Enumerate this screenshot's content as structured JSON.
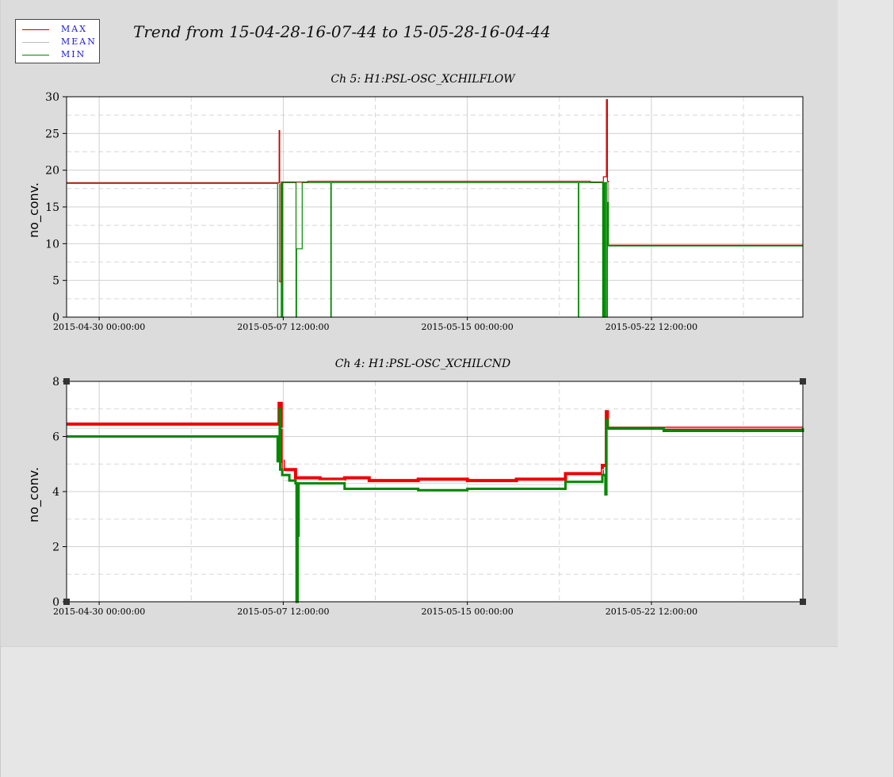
{
  "title": "Trend from 15-04-28-16-07-44 to 15-05-28-16-04-44",
  "legend": [
    {
      "label": "MAX",
      "color": "#cc0000"
    },
    {
      "label": "MEAN",
      "color": "#bbbbbb"
    },
    {
      "label": "MIN",
      "color": "#008800"
    }
  ],
  "chart_data": [
    {
      "type": "line",
      "title": "Ch 5: H1:PSL-OSC_XCHILFLOW",
      "ylabel": "no_conv.",
      "xlabel": "",
      "ylim": [
        0,
        30
      ],
      "xlim": [
        "2015-04-28 16:07:44",
        "2015-05-28 16:04:44"
      ],
      "yticks": [
        0,
        5,
        10,
        15,
        20,
        25,
        30
      ],
      "xticks": [
        "2015-04-30 00:00:00",
        "2015-05-07 12:00:00",
        "2015-05-15 00:00:00",
        "2015-05-22 12:00:00"
      ],
      "grid": true,
      "series": [
        {
          "name": "MAX",
          "color": "#cc0000",
          "x": [
            "2015-04-28 16:07:44",
            "2015-05-07 06:00:00",
            "2015-05-07 08:00:00",
            "2015-05-07 08:30:00",
            "2015-05-07 10:00:00",
            "2015-05-08 00:00:00",
            "2015-05-08 12:00:00",
            "2015-05-09 00:00:00",
            "2015-05-14 00:00:00",
            "2015-05-20 00:00:00",
            "2015-05-20 13:00:00",
            "2015-05-20 16:00:00",
            "2015-05-20 17:00:00",
            "2015-05-20 18:00:00",
            "2015-05-28 16:04:44"
          ],
          "y": [
            18.3,
            18.3,
            25.4,
            4.8,
            18.4,
            18.4,
            18.5,
            18.5,
            18.5,
            18.4,
            19.1,
            29.6,
            18.5,
            9.8,
            9.8
          ]
        },
        {
          "name": "MEAN",
          "color": "#bbbbbb",
          "x": [
            "2015-04-28 16:07:44",
            "2015-05-07 06:00:00",
            "2015-05-07 10:00:00",
            "2015-05-20 16:00:00",
            "2015-05-20 18:00:00",
            "2015-05-28 16:04:44"
          ],
          "y": [
            18.2,
            18.2,
            18.3,
            18.3,
            9.7,
            9.7
          ]
        },
        {
          "name": "MIN",
          "color": "#008800",
          "x": [
            "2015-04-28 16:07:44",
            "2015-05-07 06:00:00",
            "2015-05-07 06:30:00",
            "2015-05-07 07:00:00",
            "2015-05-07 09:00:00",
            "2015-05-07 09:30:00",
            "2015-05-07 10:00:00",
            "2015-05-07 10:30:00",
            "2015-05-07 11:00:00",
            "2015-05-07 11:30:00",
            "2015-05-07 12:00:00",
            "2015-05-08 00:00:00",
            "2015-05-08 00:30:00",
            "2015-05-08 01:00:00",
            "2015-05-08 06:00:00",
            "2015-05-08 06:30:00",
            "2015-05-08 08:00:00",
            "2015-05-08 08:30:00",
            "2015-05-08 09:00:00",
            "2015-05-09 10:00:00",
            "2015-05-09 10:30:00",
            "2015-05-09 11:00:00",
            "2015-05-19 12:00:00",
            "2015-05-19 12:30:00",
            "2015-05-19 13:00:00",
            "2015-05-20 12:00:00",
            "2015-05-20 12:20:00",
            "2015-05-20 12:40:00",
            "2015-05-20 13:00:00",
            "2015-05-20 13:20:00",
            "2015-05-20 13:40:00",
            "2015-05-20 14:00:00",
            "2015-05-20 15:00:00",
            "2015-05-20 15:20:00",
            "2015-05-20 16:00:00",
            "2015-05-20 16:30:00",
            "2015-05-20 17:00:00",
            "2015-05-20 18:00:00",
            "2015-05-28 16:04:44"
          ],
          "y": [
            18.2,
            18.2,
            0,
            0,
            0,
            0,
            18.2,
            18.3,
            0,
            18.3,
            18.3,
            18.3,
            0,
            9.3,
            9.3,
            18.3,
            18.3,
            18.3,
            18.3,
            18.3,
            0,
            18.3,
            18.3,
            0,
            18.3,
            18.3,
            0,
            18.3,
            0,
            18.3,
            0,
            18.3,
            0,
            18.3,
            18.3,
            0,
            15.6,
            9.7,
            9.7
          ]
        }
      ]
    },
    {
      "type": "line",
      "title": "Ch 4: H1:PSL-OSC_XCHILCND",
      "ylabel": "no_conv.",
      "xlabel": "",
      "ylim": [
        0,
        8
      ],
      "xlim": [
        "2015-04-28 16:07:44",
        "2015-05-28 16:04:44"
      ],
      "yticks": [
        0,
        2,
        4,
        6,
        8
      ],
      "xticks": [
        "2015-04-30 00:00:00",
        "2015-05-07 12:00:00",
        "2015-05-15 00:00:00",
        "2015-05-22 12:00:00"
      ],
      "grid": true,
      "series": [
        {
          "name": "MAX",
          "color": "#ee0000",
          "x": [
            "2015-04-28 16:07:44",
            "2015-05-07 06:00:00",
            "2015-05-07 08:00:00",
            "2015-05-07 10:00:00",
            "2015-05-07 12:00:00",
            "2015-05-08 00:00:00",
            "2015-05-09 00:00:00",
            "2015-05-10 00:00:00",
            "2015-05-11 00:00:00",
            "2015-05-13 00:00:00",
            "2015-05-15 00:00:00",
            "2015-05-17 00:00:00",
            "2015-05-19 00:00:00",
            "2015-05-20 12:00:00",
            "2015-05-20 16:00:00",
            "2015-05-20 17:00:00",
            "2015-05-22 00:00:00",
            "2015-05-26 00:00:00",
            "2015-05-26 12:00:00",
            "2015-05-28 16:04:44"
          ],
          "y": [
            6.45,
            6.45,
            7.2,
            5.1,
            4.8,
            4.5,
            4.45,
            4.5,
            4.4,
            4.45,
            4.4,
            4.45,
            4.65,
            4.95,
            6.9,
            6.3,
            6.3,
            6.3,
            6.3,
            6.3
          ]
        },
        {
          "name": "MEAN",
          "color": "#dddddd",
          "x": [
            "2015-04-28 16:07:44",
            "2015-05-07 06:00:00",
            "2015-05-07 12:00:00",
            "2015-05-10 00:00:00",
            "2015-05-15 00:00:00",
            "2015-05-20 12:00:00",
            "2015-05-20 17:00:00",
            "2015-05-28 16:04:44"
          ],
          "y": [
            6.3,
            6.3,
            4.4,
            4.3,
            4.25,
            4.8,
            6.3,
            6.3
          ]
        },
        {
          "name": "MIN",
          "color": "#008800",
          "x": [
            "2015-04-28 16:07:44",
            "2015-05-07 06:00:00",
            "2015-05-07 06:30:00",
            "2015-05-07 08:00:00",
            "2015-05-07 08:30:00",
            "2015-05-07 09:00:00",
            "2015-05-07 11:00:00",
            "2015-05-07 18:00:00",
            "2015-05-08 00:00:00",
            "2015-05-08 01:00:00",
            "2015-05-08 01:30:00",
            "2015-05-08 02:00:00",
            "2015-05-08 03:00:00",
            "2015-05-08 04:00:00",
            "2015-05-09 00:00:00",
            "2015-05-10 00:00:00",
            "2015-05-11 00:00:00",
            "2015-05-13 00:00:00",
            "2015-05-15 00:00:00",
            "2015-05-17 00:00:00",
            "2015-05-19 00:00:00",
            "2015-05-20 12:00:00",
            "2015-05-20 15:00:00",
            "2015-05-20 16:00:00",
            "2015-05-20 17:00:00",
            "2015-05-22 00:00:00",
            "2015-05-23 00:00:00",
            "2015-05-28 16:04:44"
          ],
          "y": [
            6.0,
            6.0,
            5.1,
            5.1,
            7.0,
            4.8,
            4.6,
            4.4,
            4.3,
            0,
            0,
            2.4,
            4.3,
            4.3,
            4.3,
            4.1,
            4.1,
            4.05,
            4.1,
            4.1,
            4.35,
            4.6,
            3.9,
            6.6,
            6.3,
            6.3,
            6.2,
            6.3
          ]
        }
      ]
    }
  ]
}
